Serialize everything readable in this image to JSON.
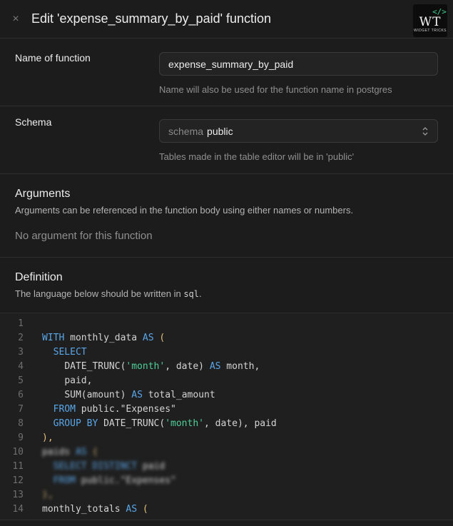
{
  "header": {
    "close_icon": "×",
    "title": "Edit 'expense_summary_by_paid' function",
    "logo_code": "</>",
    "logo_text": "WT",
    "logo_sub": "WIDGET TRICKS"
  },
  "name_row": {
    "label": "Name of function",
    "value": "expense_summary_by_paid",
    "help": "Name will also be used for the function name in postgres"
  },
  "schema_row": {
    "label": "Schema",
    "prefix": "schema",
    "value": "public",
    "help": "Tables made in the table editor will be in 'public'"
  },
  "arguments": {
    "title": "Arguments",
    "description": "Arguments can be referenced in the function body using either names or numbers.",
    "empty": "No argument for this function"
  },
  "definition": {
    "title": "Definition",
    "description_prefix": "The language below should be written in ",
    "language": "sql",
    "description_suffix": "."
  },
  "editor": {
    "line_numbers": [
      "1",
      "2",
      "3",
      "4",
      "5",
      "6",
      "7",
      "8",
      "9",
      "10",
      "11",
      "12",
      "13",
      "14"
    ],
    "l2_a": "WITH",
    "l2_b": " monthly_data ",
    "l2_c": "AS",
    "l2_d": " (",
    "l3_a": "SELECT",
    "l4_a": "DATE_TRUNC(",
    "l4_b": "'month'",
    "l4_c": ", date) ",
    "l4_d": "AS",
    "l4_e": " month,",
    "l5_a": "paid,",
    "l6_a": "SUM",
    "l6_b": "(amount) ",
    "l6_c": "AS",
    "l6_d": " total_amount",
    "l7_a": "FROM",
    "l7_b": " public.\"Expenses\"",
    "l8_a": "GROUP BY",
    "l8_b": " DATE_TRUNC(",
    "l8_c": "'month'",
    "l8_d": ", date), paid",
    "l9_a": "),",
    "l10_a": "paids ",
    "l10_b": "AS",
    "l10_c": " (",
    "l11_a": "SELECT DISTINCT",
    "l11_b": " paid",
    "l12_a": "FROM",
    "l12_b": " public.\"Expenses\"",
    "l13_a": "),",
    "l14_a": "monthly_totals ",
    "l14_b": "AS",
    "l14_c": " ("
  }
}
